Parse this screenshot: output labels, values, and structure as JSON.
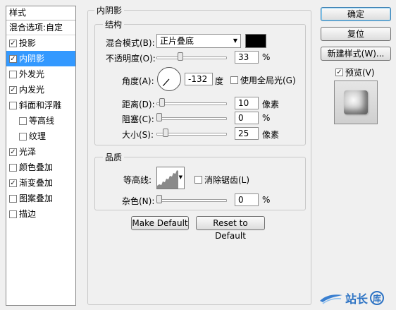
{
  "sidebar": {
    "header": "样式",
    "blend_options": "混合选项:自定",
    "items": [
      {
        "label": "投影",
        "checked": true,
        "indent": false,
        "selected": false
      },
      {
        "label": "内阴影",
        "checked": true,
        "indent": false,
        "selected": true
      },
      {
        "label": "外发光",
        "checked": false,
        "indent": false,
        "selected": false
      },
      {
        "label": "内发光",
        "checked": true,
        "indent": false,
        "selected": false
      },
      {
        "label": "斜面和浮雕",
        "checked": false,
        "indent": false,
        "selected": false
      },
      {
        "label": "等高线",
        "checked": false,
        "indent": true,
        "selected": false
      },
      {
        "label": "纹理",
        "checked": false,
        "indent": true,
        "selected": false
      },
      {
        "label": "光泽",
        "checked": true,
        "indent": false,
        "selected": false
      },
      {
        "label": "颜色叠加",
        "checked": false,
        "indent": false,
        "selected": false
      },
      {
        "label": "渐变叠加",
        "checked": true,
        "indent": false,
        "selected": false
      },
      {
        "label": "图案叠加",
        "checked": false,
        "indent": false,
        "selected": false
      },
      {
        "label": "描边",
        "checked": false,
        "indent": false,
        "selected": false
      }
    ]
  },
  "panel": {
    "title": "内阴影",
    "structure": {
      "title": "结构",
      "blend_mode_label": "混合模式(B):",
      "blend_mode_value": "正片叠底",
      "shadow_color": "#000000",
      "opacity_label": "不透明度(O):",
      "opacity_value": "33",
      "opacity_unit": "%",
      "opacity_level": 0.33,
      "angle_label": "角度(A):",
      "angle_value": "-132",
      "angle_unit": "度",
      "global_light_label": "使用全局光(G)",
      "global_light_checked": false,
      "distance_label": "距离(D):",
      "distance_value": "10",
      "distance_unit": "像素",
      "distance_level": 0.04,
      "choke_label": "阻塞(C):",
      "choke_value": "0",
      "choke_unit": "%",
      "choke_level": 0.0,
      "size_label": "大小(S):",
      "size_value": "25",
      "size_unit": "像素",
      "size_level": 0.1
    },
    "quality": {
      "title": "品质",
      "contour_label": "等高线:",
      "anti_alias_label": "消除锯齿(L)",
      "anti_alias_checked": false,
      "noise_label": "杂色(N):",
      "noise_value": "0",
      "noise_unit": "%",
      "noise_level": 0.0
    },
    "make_default": "Make Default",
    "reset_default": "Reset to Default"
  },
  "actions": {
    "ok": "确定",
    "reset": "复位",
    "new_style": "新建样式(W)...",
    "preview_label": "预览(V)",
    "preview_checked": true
  },
  "watermark": {
    "text": "站长",
    "badge": "库"
  }
}
